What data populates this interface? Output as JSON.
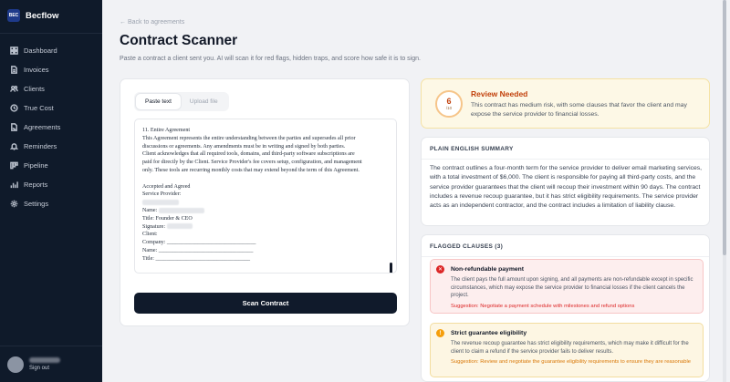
{
  "brand": {
    "logo_text": "BEC",
    "name": "Becflow"
  },
  "sidebar": {
    "items": [
      {
        "label": "Dashboard",
        "icon": "grid-icon"
      },
      {
        "label": "Invoices",
        "icon": "document-icon"
      },
      {
        "label": "Clients",
        "icon": "users-icon"
      },
      {
        "label": "True Cost",
        "icon": "clock-icon"
      },
      {
        "label": "Agreements",
        "icon": "file-signature-icon"
      },
      {
        "label": "Reminders",
        "icon": "bell-icon"
      },
      {
        "label": "Pipeline",
        "icon": "pipeline-icon"
      },
      {
        "label": "Reports",
        "icon": "bar-chart-icon"
      },
      {
        "label": "Settings",
        "icon": "gear-icon"
      }
    ],
    "footer": {
      "signout_label": "Sign out"
    }
  },
  "header": {
    "back_label": "← Back to agreements",
    "title": "Contract Scanner",
    "subtitle": "Paste a contract a client sent you. AI will scan it for red flags, hidden traps, and score how safe it is to sign."
  },
  "scanner": {
    "tabs": [
      {
        "label": "Paste text",
        "active": true
      },
      {
        "label": "Upload file",
        "active": false
      }
    ],
    "contract_lines": [
      "11. Entire Agreement",
      "This Agreement represents the entire understanding between the parties and supersedes all prior",
      "discussions or agreements. Any amendments must be in writing and signed by both parties.",
      "Client acknowledges that all required tools, domains, and third-party software subscriptions are",
      "paid for directly by the Client. Service Provider's fee covers setup, configuration, and management",
      "only. These tools are recurring monthly costs that may extend beyond the term of this Agreement."
    ],
    "signature_block": {
      "heading": "Accepted and Agreed",
      "provider_label": "Service Provider:",
      "name_label": "Name:",
      "title_label": "Title: Founder & CEO",
      "signature_label": "Signature:",
      "client_label": "Client:",
      "company_line": "Company: ________________________________",
      "client_name_line": "Name: __________________________________",
      "client_title_line": "Title: __________________________________"
    },
    "scan_button_label": "Scan Contract"
  },
  "review": {
    "score": "6",
    "score_max": "/10",
    "title": "Review Needed",
    "description": "This contract has medium risk, with some clauses that favor the client and may expose the service provider to financial losses.",
    "accent_color": "#c2410c"
  },
  "summary": {
    "heading": "PLAIN ENGLISH SUMMARY",
    "text": "The contract outlines a four-month term for the service provider to deliver email marketing services, with a total investment of $6,000. The client is responsible for paying all third-party costs, and the service provider guarantees that the client will recoup their investment within 90 days. The contract includes a revenue recoup guarantee, but it has strict eligibility requirements. The service provider acts as an independent contractor, and the contract includes a limitation of liability clause."
  },
  "flagged": {
    "heading": "FLAGGED CLAUSES (3)",
    "clauses": [
      {
        "severity": "high",
        "icon_glyph": "✕",
        "title": "Non-refundable payment",
        "description": "The client pays the full amount upon signing, and all payments are non-refundable except in specific circumstances, which may expose the service provider to financial losses if the client cancels the project.",
        "suggestion": "Suggestion: Negotiate a payment schedule with milestones and refund options"
      },
      {
        "severity": "medium",
        "icon_glyph": "!",
        "title": "Strict guarantee eligibility",
        "description": "The revenue recoup guarantee has strict eligibility requirements, which may make it difficult for the client to claim a refund if the service provider fails to deliver results.",
        "suggestion": "Suggestion: Review and negotiate the guarantee eligibility requirements to ensure they are reasonable"
      }
    ]
  }
}
